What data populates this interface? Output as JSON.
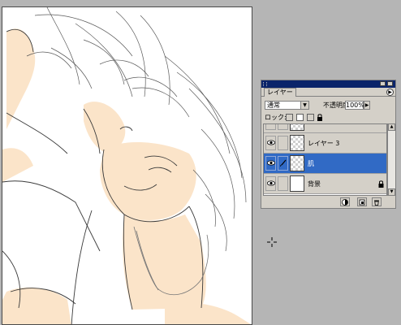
{
  "palette": {
    "tab_label": "レイヤー",
    "blend_mode": "通常",
    "opacity_label": "不透明度:",
    "opacity_value": "100%",
    "lock_label": "ロック:"
  },
  "layers": [
    {
      "name": "",
      "visible": false,
      "thumbnail": "transparent"
    },
    {
      "name": "レイヤー 3",
      "visible": true,
      "thumbnail": "transparent"
    },
    {
      "name": "肌",
      "visible": true,
      "selected": true,
      "thumbnail": "transparent"
    },
    {
      "name": "背景",
      "visible": true,
      "locked": true,
      "thumbnail": "white"
    }
  ],
  "bottom_buttons": [
    "adjustment-layer-icon",
    "new-layer-icon",
    "trash-icon"
  ],
  "colors": {
    "workspace": "#b5b5b5",
    "palette_bg": "#d4d0c8",
    "titlebar": "#0a246a",
    "selection": "#316ac5",
    "skin_fill": "#fbe4c9"
  }
}
